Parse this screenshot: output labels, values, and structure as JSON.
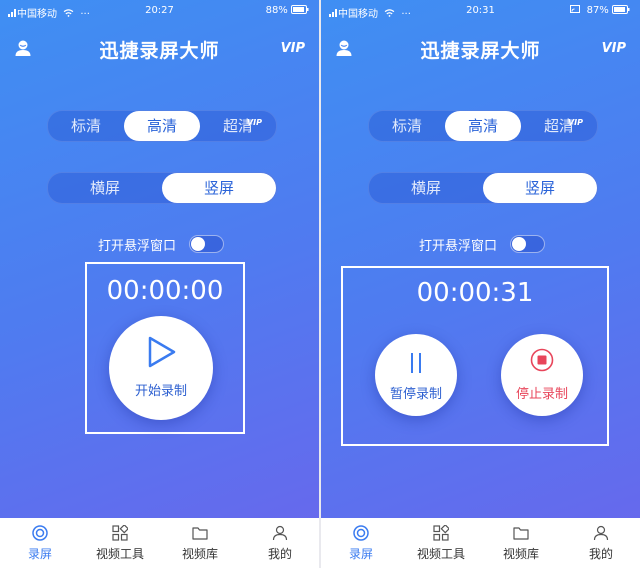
{
  "screens": [
    {
      "status": {
        "carrier": "中国移动",
        "time": "20:27",
        "battery": "88%"
      },
      "header": {
        "title": "迅捷录屏大师",
        "vip": "VIP",
        "user_icon": "user-icon"
      },
      "quality": {
        "options": [
          "标清",
          "高清",
          "超清"
        ],
        "selected": "高清",
        "vip_badge": "VIP"
      },
      "orientation": {
        "options": [
          "横屏",
          "竖屏"
        ],
        "selected": "竖屏"
      },
      "floating_window": {
        "label": "打开悬浮窗口",
        "enabled": false
      },
      "recorder": {
        "timer": "00:00:00",
        "start_label": "开始录制",
        "icon": "play-icon"
      },
      "tabs": [
        {
          "label": "录屏",
          "icon": "record-icon",
          "active": true
        },
        {
          "label": "视频工具",
          "icon": "grid-icon",
          "active": false
        },
        {
          "label": "视频库",
          "icon": "folder-icon",
          "active": false
        },
        {
          "label": "我的",
          "icon": "person-icon",
          "active": false
        }
      ]
    },
    {
      "status": {
        "carrier": "中国移动",
        "time": "20:31",
        "battery": "87%"
      },
      "header": {
        "title": "迅捷录屏大师",
        "vip": "VIP",
        "user_icon": "user-icon"
      },
      "quality": {
        "options": [
          "标清",
          "高清",
          "超清"
        ],
        "selected": "高清",
        "vip_badge": "VIP"
      },
      "orientation": {
        "options": [
          "横屏",
          "竖屏"
        ],
        "selected": "竖屏"
      },
      "floating_window": {
        "label": "打开悬浮窗口",
        "enabled": false
      },
      "recorder": {
        "timer": "00:00:31",
        "pause_label": "暂停录制",
        "stop_label": "停止录制",
        "pause_icon": "pause-icon",
        "stop_icon": "stop-icon"
      },
      "tabs": [
        {
          "label": "录屏",
          "icon": "record-icon",
          "active": true
        },
        {
          "label": "视频工具",
          "icon": "grid-icon",
          "active": false
        },
        {
          "label": "视频库",
          "icon": "folder-icon",
          "active": false
        },
        {
          "label": "我的",
          "icon": "person-icon",
          "active": false
        }
      ]
    }
  ],
  "colors": {
    "accent": "#3a7bf0",
    "stop_red": "#e8455a",
    "bg_top": "#3f8ff3",
    "bg_bottom": "#6a66ec"
  }
}
